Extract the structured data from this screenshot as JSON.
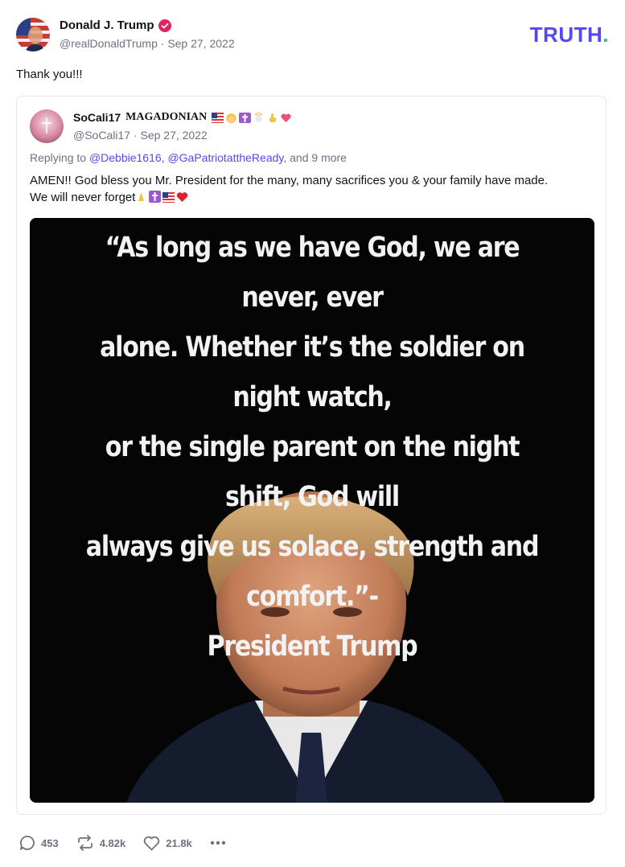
{
  "post": {
    "author_name": "Donald J. Trump",
    "handle": "@realDonaldTrump",
    "date": "Sep 27, 2022",
    "text": "Thank you!!!",
    "brand": "TRUTH",
    "brand_dot": "."
  },
  "quoted": {
    "author_name": "SoCali17",
    "author_suffix": "MAGADONIAN",
    "handle": "@SoCali17",
    "date": "Sep 27, 2022",
    "replying_prefix": "Replying to",
    "mentions": "@Debbie1616, @GaPatriotattheReady",
    "replying_suffix": ", and 9 more",
    "body_line1": "AMEN!! God bless you Mr. President for the many, many sacrifices you & your family have made.",
    "body_line2": "We will never forget",
    "image": {
      "quote_line1": "“As long as we have God, we are never, ever",
      "quote_line2": "alone. Whether it’s the soldier on night watch,",
      "quote_line3": "or the single parent on the night shift, God will",
      "quote_line4": "always give us solace, strength and comfort.”-",
      "quote_line5": "President Trump"
    }
  },
  "actions": {
    "replies": "453",
    "retruths": "4.82k",
    "likes": "21.8k"
  },
  "colors": {
    "brand": "#5448ee",
    "brand_dot": "#14c4a0",
    "muted": "#6b7280",
    "verified": "#e0245e"
  }
}
